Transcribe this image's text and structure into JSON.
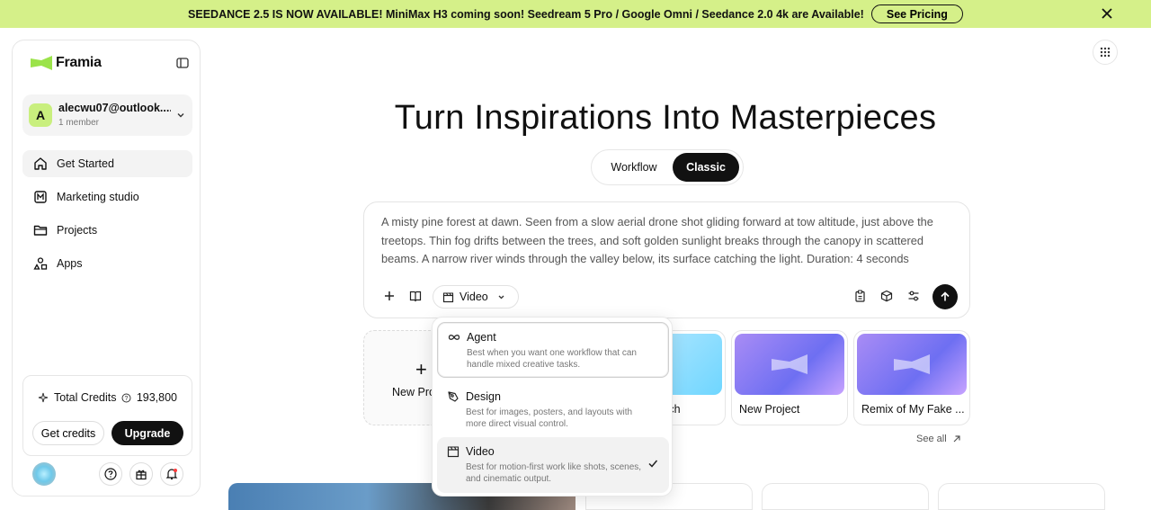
{
  "banner": {
    "message": "SEEDANCE 2.5 IS NOW AVAILABLE! MiniMax H3 coming soon! Seedream 5 Pro / Google Omni / Seedance 2.0 4k are Available!",
    "pricing_label": "See Pricing"
  },
  "sidebar": {
    "brand": "Framia",
    "account": {
      "initial": "A",
      "email": "alecwu07@outlook....",
      "members": "1 member"
    },
    "nav": [
      {
        "label": "Get Started",
        "icon": "home-icon"
      },
      {
        "label": "Marketing studio",
        "icon": "m-box-icon"
      },
      {
        "label": "Projects",
        "icon": "folder-icon"
      },
      {
        "label": "Apps",
        "icon": "apps-icon"
      }
    ],
    "credits": {
      "label": "Total Credits",
      "value": "193,800",
      "get_label": "Get credits",
      "upgrade_label": "Upgrade"
    }
  },
  "main": {
    "title": "Turn Inspirations Into Masterpieces",
    "toggle": {
      "option_a": "Workflow",
      "option_b": "Classic",
      "selected": "Classic"
    },
    "prompt": {
      "text": "A misty pine forest at dawn. Seen from a slow aerial drone shot gliding forward at tow altitude, just above the treetops. Thin fog drifts between the trees, and soft golden sunlight breaks through the canopy in scattered beams. A narrow river winds through the valley below, its surface catching the light. Duration: 4 seconds",
      "mode": "Video"
    },
    "projects": {
      "new_label": "New Pro",
      "cards": [
        {
          "label": "...uch"
        },
        {
          "label": "New Project"
        },
        {
          "label": "Remix of My Fake ..."
        }
      ],
      "see_all": "See all"
    }
  },
  "dropdown": {
    "options": [
      {
        "title": "Agent",
        "desc": "Best when you want one workflow that can handle mixed creative tasks.",
        "selected": false
      },
      {
        "title": "Design",
        "desc": "Best for images, posters, and layouts with more direct visual control.",
        "selected": false
      },
      {
        "title": "Video",
        "desc": "Best for motion-first work like shots, scenes, and cinematic output.",
        "selected": true
      }
    ]
  },
  "colors": {
    "banner": "#d5f089",
    "accent": "#c9ef7e",
    "primary": "#111111"
  }
}
